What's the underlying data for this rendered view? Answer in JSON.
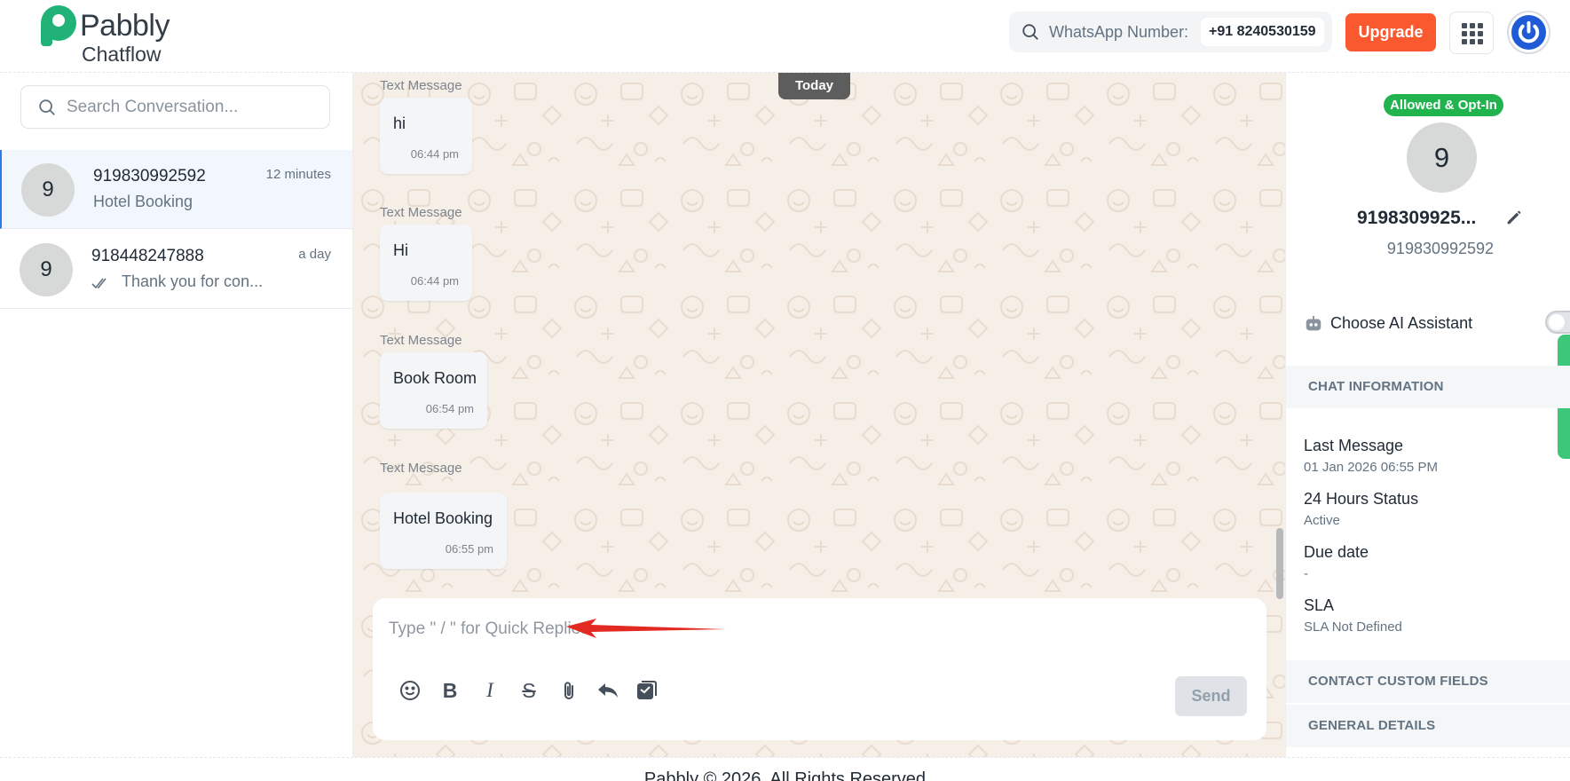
{
  "brand": {
    "name_top": "Pabbly",
    "name_bottom": "Chatflow",
    "color": "#20b276"
  },
  "header": {
    "whatsapp_label": "WhatsApp Number:",
    "whatsapp_number": "+91 8240530159",
    "upgrade_label": "Upgrade",
    "upgrade_color": "#fa5930"
  },
  "sidebar": {
    "search_placeholder": "Search Conversation...",
    "conversations": [
      {
        "avatar": "9",
        "name": "919830992592",
        "preview": "Hotel Booking",
        "time": "12 minutes",
        "active": true
      },
      {
        "avatar": "9",
        "name": "918448247888",
        "preview": "Thank you for con...",
        "time": "a day",
        "active": false
      }
    ]
  },
  "chat": {
    "date_divider": "Today",
    "messages": [
      {
        "label": "Text Message",
        "text": "hi",
        "time": "06:44 pm"
      },
      {
        "label": "Text Message",
        "text": "Hi",
        "time": "06:44 pm"
      },
      {
        "label": "Text Message",
        "text": "Book Room",
        "time": "06:54 pm"
      },
      {
        "label": "Text Message",
        "text": "Hotel Booking",
        "time": "06:55 pm"
      }
    ],
    "composer": {
      "placeholder": "Type \" / \" for Quick Replies",
      "send_label": "Send",
      "tools": [
        "emoji-icon",
        "bold-icon",
        "italic-icon",
        "strikethrough-icon",
        "attachment-icon",
        "reply-icon",
        "template-icon"
      ]
    }
  },
  "contact": {
    "badge": "Allowed & Opt-In",
    "badge_color": "#20b34e",
    "avatar": "9",
    "name": "9198309925...",
    "phone": "919830992592",
    "ai_label": "Choose AI Assistant",
    "sections": {
      "chat_information": "CHAT INFORMATION",
      "contact_custom_fields": "CONTACT CUSTOM FIELDS",
      "general_details": "GENERAL DETAILS"
    },
    "info": [
      {
        "label": "Last Message",
        "value": "01 Jan 2026 06:55 PM"
      },
      {
        "label": "24 Hours Status",
        "value": "Active"
      },
      {
        "label": "Due date",
        "value": "-"
      },
      {
        "label": "SLA",
        "value": "SLA Not Defined"
      }
    ]
  },
  "footer": {
    "text": "Pabbly © 2026, All Rights Reserved"
  }
}
